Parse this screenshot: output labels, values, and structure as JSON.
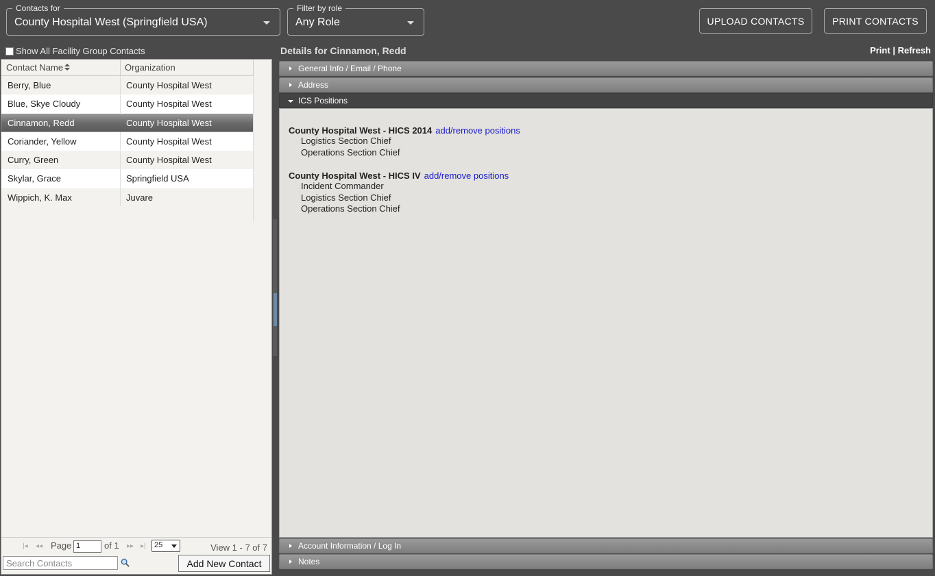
{
  "top": {
    "contacts_for": {
      "legend": "Contacts for",
      "value": "County Hospital West (Springfield USA)"
    },
    "filter_role": {
      "legend": "Filter by role",
      "value": "Any Role"
    },
    "upload_label": "UPLOAD CONTACTS",
    "print_label": "PRINT CONTACTS"
  },
  "left": {
    "show_all_label": "Show All Facility Group Contacts",
    "columns": {
      "name": "Contact Name",
      "org": "Organization"
    },
    "rows": [
      {
        "name": "Berry, Blue",
        "org": "County Hospital West"
      },
      {
        "name": "Blue, Skye Cloudy",
        "org": "County Hospital West"
      },
      {
        "name": "Cinnamon, Redd",
        "org": "County Hospital West"
      },
      {
        "name": "Coriander, Yellow",
        "org": "County Hospital West"
      },
      {
        "name": "Curry, Green",
        "org": "County Hospital West"
      },
      {
        "name": "Skylar, Grace",
        "org": "Springfield USA"
      },
      {
        "name": "Wippich, K. Max",
        "org": "Juvare"
      }
    ],
    "pager": {
      "page_label": "Page",
      "page_value": "1",
      "of_label": "of 1",
      "page_size": "25",
      "view_info": "View 1 - 7 of 7"
    },
    "search_placeholder": "Search Contacts",
    "add_label": "Add New Contact"
  },
  "right": {
    "details_title": "Details for Cinnamon, Redd",
    "print": "Print",
    "separator": "|",
    "refresh": "Refresh",
    "sections": {
      "general": "General Info / Email / Phone",
      "address": "Address",
      "ics": "ICS Positions",
      "account": "Account Information / Log In",
      "notes": "Notes"
    },
    "ics_groups": [
      {
        "title": "County Hospital West - HICS 2014",
        "link": "add/remove positions",
        "positions": [
          "Logistics Section Chief",
          "Operations Section Chief"
        ]
      },
      {
        "title": "County Hospital West - HICS IV",
        "link": "add/remove positions",
        "positions": [
          "Incident Commander",
          "Logistics Section Chief",
          "Operations Section Chief"
        ]
      }
    ]
  },
  "colors": {
    "background": "#4a4a4a",
    "link": "#1a1acc",
    "selected_row": "#6c6c6c"
  }
}
